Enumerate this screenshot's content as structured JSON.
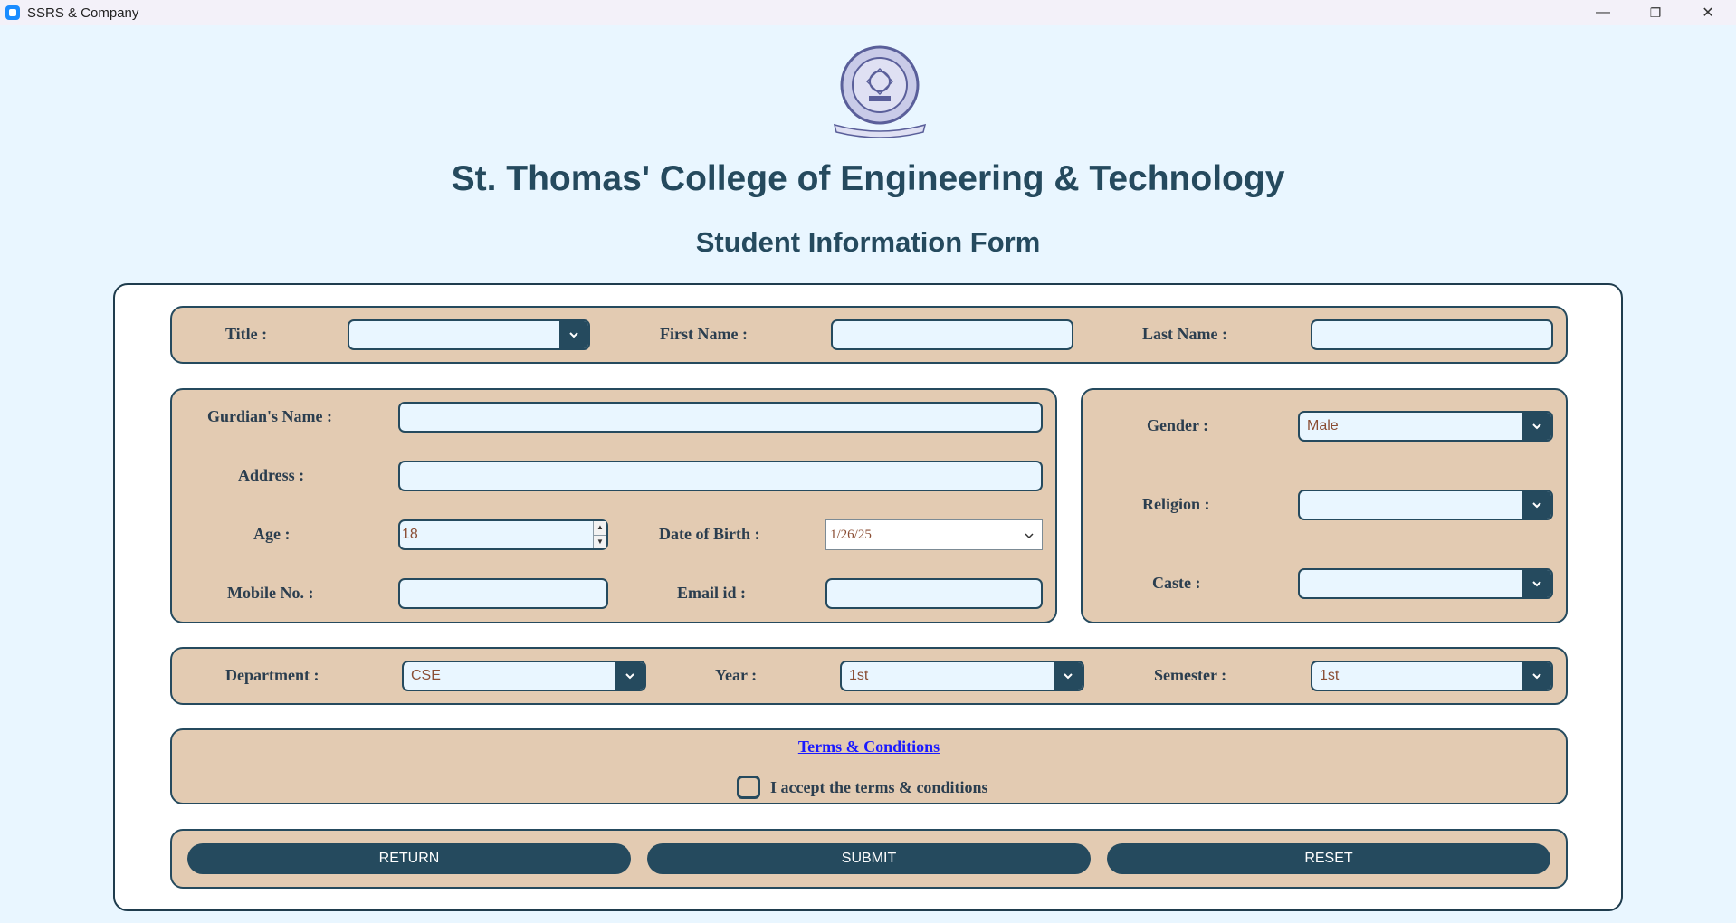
{
  "window": {
    "title": "SSRS & Company",
    "minimize": "—",
    "restore": "❐",
    "close": "✕"
  },
  "header": {
    "college_name": "St. Thomas' College of Engineering & Technology",
    "form_title": "Student Information Form",
    "logo_icon": "college-seal-icon"
  },
  "name_section": {
    "title_label": "Title   :",
    "title_value": "",
    "first_name_label": "First Name   :",
    "first_name_value": "",
    "last_name_label": "Last Name   :",
    "last_name_value": ""
  },
  "details_section": {
    "guardian_label": "Gurdian's Name   :",
    "guardian_value": "",
    "address_label": "Address   :",
    "address_value": "",
    "age_label": "Age   :",
    "age_value": "18",
    "dob_label": "Date of Birth   :",
    "dob_value": "1/26/25",
    "mobile_label": "Mobile No.   :",
    "mobile_value": "",
    "email_label": "Email id   :",
    "email_value": ""
  },
  "personal_section": {
    "gender_label": "Gender   :",
    "gender_value": "Male",
    "religion_label": "Religion   :",
    "religion_value": "",
    "caste_label": "Caste   :",
    "caste_value": ""
  },
  "academic_section": {
    "department_label": "Department   :",
    "department_value": "CSE",
    "year_label": "Year   :",
    "year_value": "1st",
    "semester_label": "Semester   :",
    "semester_value": "1st"
  },
  "terms": {
    "link_text": "Terms & Conditions",
    "checkbox_label": "I accept the terms & conditions",
    "checked": false
  },
  "buttons": {
    "return": "RETURN",
    "submit": "SUBMIT",
    "reset": "RESET"
  },
  "colors": {
    "background": "#e9f6ff",
    "section_fill": "#e3cbb2",
    "accent": "#254a5e",
    "value_text": "#8a4d33",
    "link": "#1a1aff"
  }
}
